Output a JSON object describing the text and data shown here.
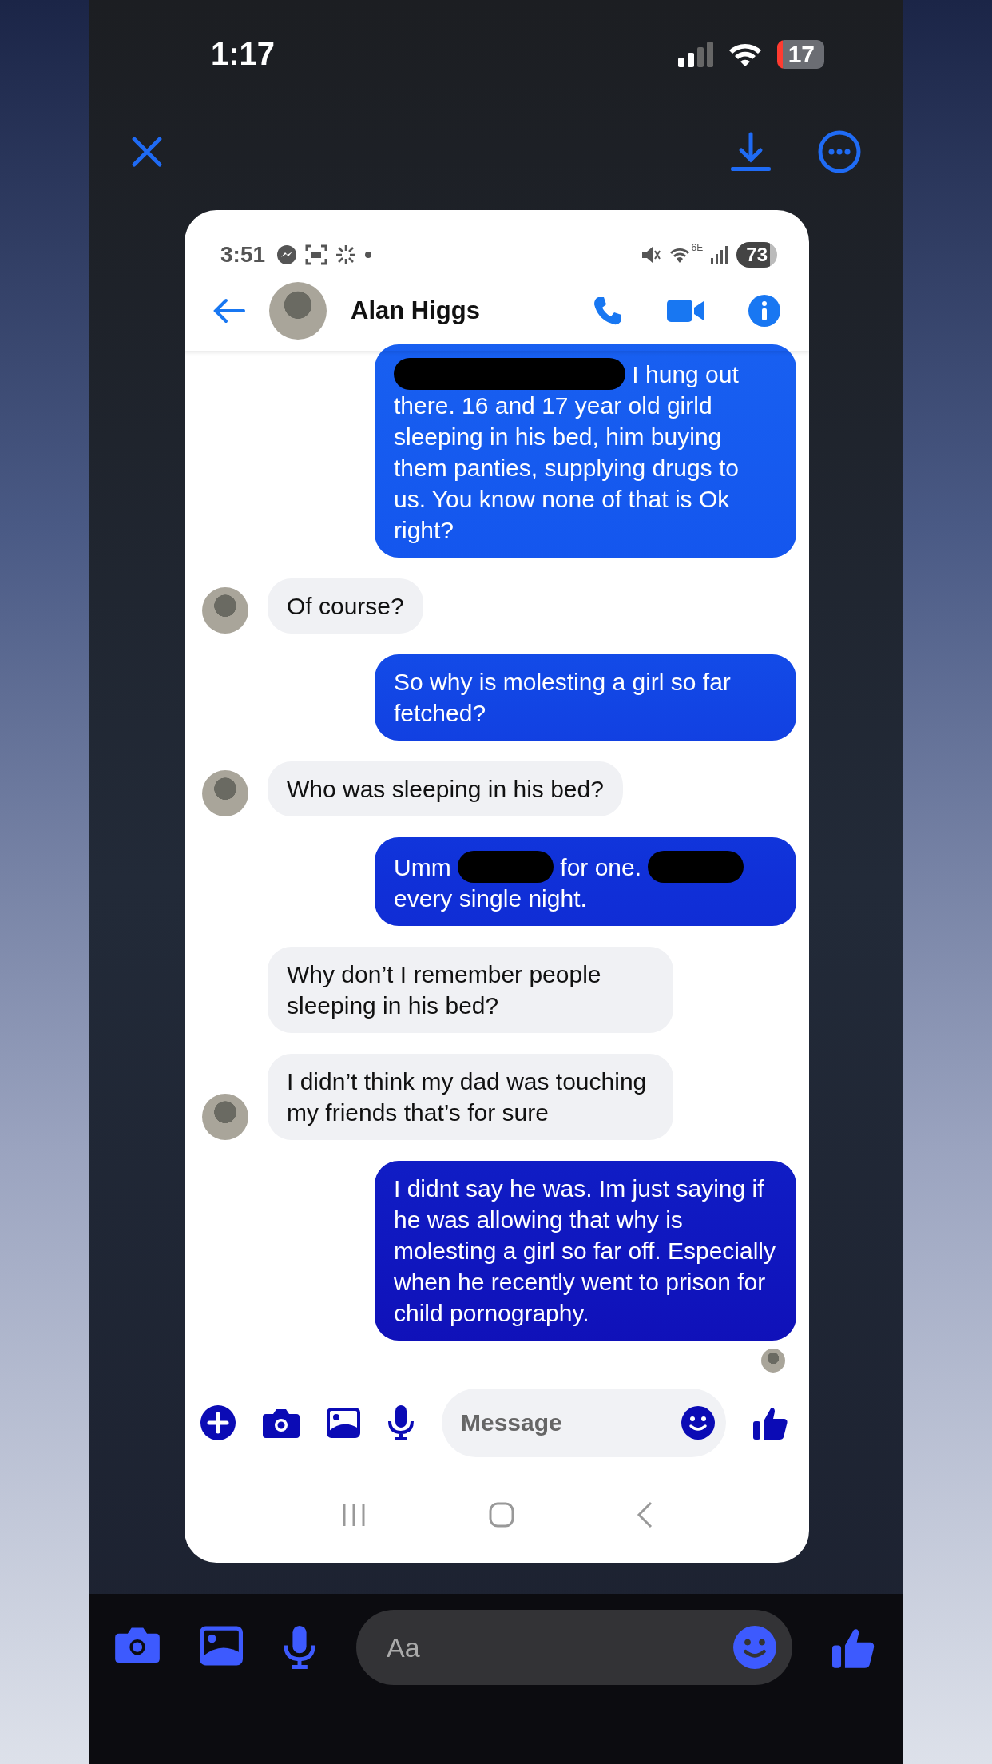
{
  "status_bar": {
    "time": "1:17",
    "battery": "17"
  },
  "screenshot": {
    "status_bar": {
      "time": "3:51",
      "network": "6E",
      "battery": "73"
    },
    "header": {
      "name": "Alan Higgs"
    },
    "messages": [
      {
        "kind": "sent",
        "parts": [
          {
            "kind": "redacted"
          },
          {
            "kind": "text",
            "text": "I hung out"
          },
          {
            "kind": "text",
            "text": "there. 16 and 17 year old girld sleeping in his bed, him buying them panties, supplying drugs to us. You know none of that is Ok right?"
          }
        ]
      },
      {
        "kind": "received",
        "avatar": true,
        "parts": [
          {
            "kind": "text",
            "text": "Of course?"
          }
        ]
      },
      {
        "kind": "sent",
        "parts": [
          {
            "kind": "text",
            "text": "So why is molesting a girl so far fetched?"
          }
        ]
      },
      {
        "kind": "received",
        "avatar": true,
        "parts": [
          {
            "kind": "text",
            "text": "Who was sleeping in his bed?"
          }
        ]
      },
      {
        "kind": "sent",
        "parts": [
          {
            "kind": "text",
            "text": "Umm"
          },
          {
            "kind": "redacted"
          },
          {
            "kind": "text",
            "text": "for one."
          },
          {
            "kind": "redacted"
          },
          {
            "kind": "text",
            "text": "every single night."
          }
        ]
      },
      {
        "kind": "received",
        "avatar": false,
        "parts": [
          {
            "kind": "text",
            "text": "Why don’t I remember people sleeping in his bed?"
          }
        ]
      },
      {
        "kind": "received",
        "avatar": true,
        "parts": [
          {
            "kind": "text",
            "text": "I didn’t think my dad was touching my friends that’s for sure"
          }
        ]
      },
      {
        "kind": "sent",
        "seen": true,
        "parts": [
          {
            "kind": "text",
            "text": "I didnt say he was.  Im just saying if he was allowing that why is molesting a girl so far off. Especially when he recently went to prison for child pornography."
          }
        ]
      }
    ],
    "composer": {
      "placeholder": "Message"
    }
  },
  "composer": {
    "placeholder": "Aa"
  }
}
